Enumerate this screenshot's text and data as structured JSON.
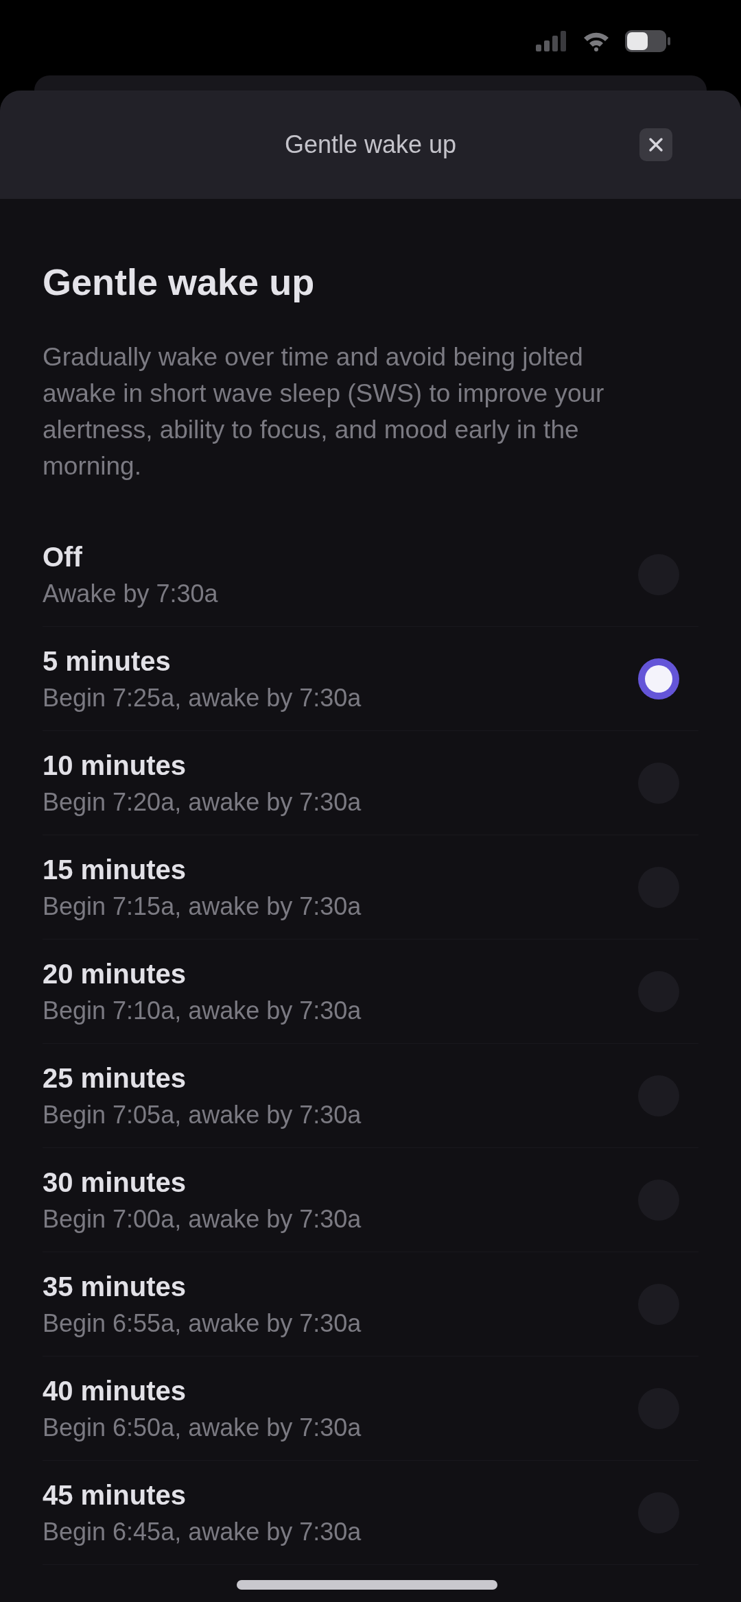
{
  "header": {
    "title": "Gentle wake up"
  },
  "heading": "Gentle wake up",
  "description": "Gradually wake over time and avoid being jolted awake in short wave sleep (SWS) to improve your alertness, ability to focus, and mood early in the morning.",
  "options": [
    {
      "label": "Off",
      "detail": "Awake by 7:30a",
      "selected": false
    },
    {
      "label": "5 minutes",
      "detail": "Begin 7:25a, awake by 7:30a",
      "selected": true
    },
    {
      "label": "10 minutes",
      "detail": "Begin 7:20a, awake by 7:30a",
      "selected": false
    },
    {
      "label": "15 minutes",
      "detail": "Begin 7:15a, awake by 7:30a",
      "selected": false
    },
    {
      "label": "20 minutes",
      "detail": "Begin 7:10a, awake by 7:30a",
      "selected": false
    },
    {
      "label": "25 minutes",
      "detail": "Begin 7:05a, awake by 7:30a",
      "selected": false
    },
    {
      "label": "30 minutes",
      "detail": "Begin 7:00a, awake by 7:30a",
      "selected": false
    },
    {
      "label": "35 minutes",
      "detail": "Begin 6:55a, awake by 7:30a",
      "selected": false
    },
    {
      "label": "40 minutes",
      "detail": "Begin 6:50a, awake by 7:30a",
      "selected": false
    },
    {
      "label": "45 minutes",
      "detail": "Begin 6:45a, awake by 7:30a",
      "selected": false
    }
  ]
}
